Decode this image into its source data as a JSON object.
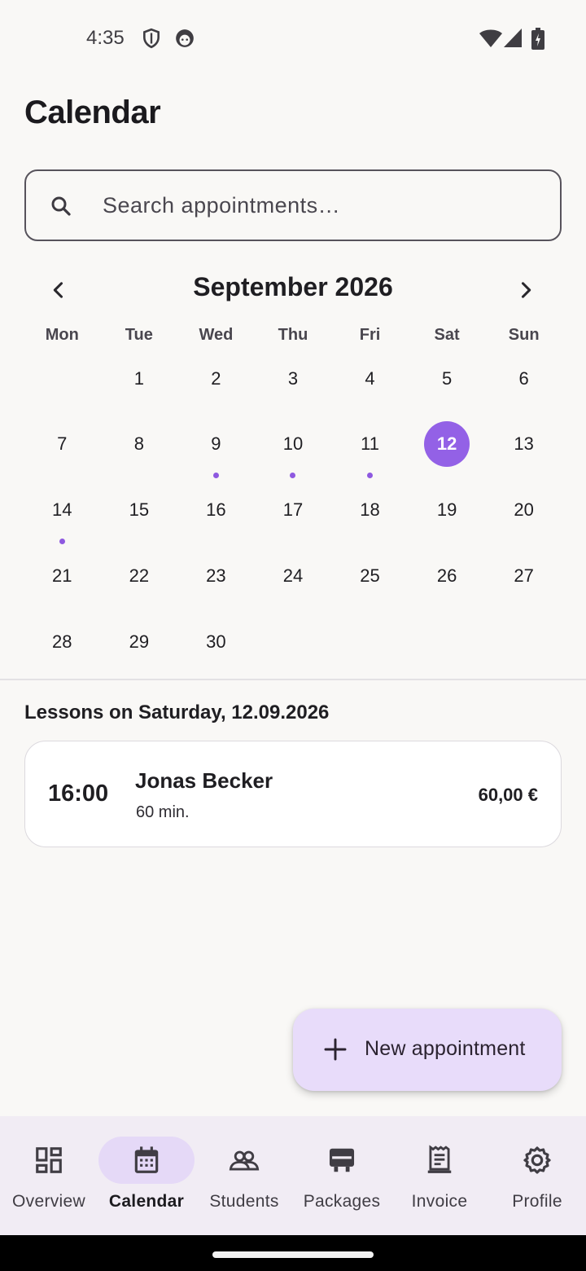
{
  "status_bar": {
    "time": "4:35"
  },
  "page": {
    "title": "Calendar"
  },
  "search": {
    "placeholder": "Search appointments…",
    "value": ""
  },
  "calendar": {
    "month_label": "September 2026",
    "weekdays": [
      "Mon",
      "Tue",
      "Wed",
      "Thu",
      "Fri",
      "Sat",
      "Sun"
    ],
    "weeks": [
      [
        "",
        "1",
        "2",
        "3",
        "4",
        "5",
        "6"
      ],
      [
        "7",
        "8",
        "9",
        "10",
        "11",
        "12",
        "13"
      ],
      [
        "14",
        "15",
        "16",
        "17",
        "18",
        "19",
        "20"
      ],
      [
        "21",
        "22",
        "23",
        "24",
        "25",
        "26",
        "27"
      ],
      [
        "28",
        "29",
        "30",
        "",
        "",
        "",
        ""
      ]
    ],
    "selected_day": "12",
    "days_with_appointments": [
      "9",
      "10",
      "11",
      "14"
    ],
    "accent_color": "#9361e6"
  },
  "lessons": {
    "title": "Lessons on Saturday, 12.09.2026",
    "items": [
      {
        "time": "16:00",
        "student": "Jonas Becker",
        "duration": "60 min.",
        "price": "60,00 €"
      }
    ]
  },
  "fab": {
    "label": "New appointment",
    "icon": "plus-icon"
  },
  "bottom_nav": {
    "items": [
      {
        "label": "Overview",
        "icon": "dashboard-icon",
        "active": false
      },
      {
        "label": "Calendar",
        "icon": "calendar-icon",
        "active": true
      },
      {
        "label": "Students",
        "icon": "people-icon",
        "active": false
      },
      {
        "label": "Packages",
        "icon": "package-icon",
        "active": false
      },
      {
        "label": "Invoice",
        "icon": "invoice-icon",
        "active": false
      },
      {
        "label": "Profile",
        "icon": "settings-icon",
        "active": false
      }
    ]
  }
}
